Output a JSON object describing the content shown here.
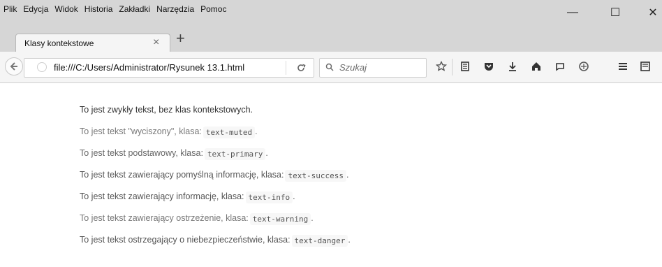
{
  "menu": {
    "items": [
      "Plik",
      "Edycja",
      "Widok",
      "Historia",
      "Zakładki",
      "Narzędzia",
      "Pomoc"
    ]
  },
  "window": {
    "minimize_label": "—",
    "maximize_label": "☐",
    "close_label": "✕"
  },
  "tab": {
    "title": "Klasy kontekstowe",
    "close_label": "×",
    "new_tab_label": "+"
  },
  "nav": {
    "url": "file:///C:/Users/Administrator/Rysunek 13.1.html",
    "search_placeholder": "Szukaj",
    "icons": [
      "star-icon",
      "reader-icon",
      "pocket-icon",
      "download-icon",
      "home-icon",
      "chat-icon",
      "sync-icon",
      "menu-icon",
      "extension-icon"
    ]
  },
  "content": {
    "lines": [
      {
        "text": "To jest zwykły tekst, bez klas kontekstowych.",
        "code": "",
        "suffix": ""
      },
      {
        "text": "To jest tekst \"wyciszony\", klasa:",
        "code": "text-muted",
        "suffix": "."
      },
      {
        "text": "To jest tekst podstawowy, klasa:",
        "code": "text-primary",
        "suffix": "."
      },
      {
        "text": "To jest tekst zawierający pomyślną informację, klasa:",
        "code": "text-success",
        "suffix": "."
      },
      {
        "text": "To jest tekst zawierający informację, klasa:",
        "code": "text-info",
        "suffix": "."
      },
      {
        "text": "To jest tekst zawierający ostrzeżenie, klasa:",
        "code": "text-warning",
        "suffix": "."
      },
      {
        "text": "To jest tekst ostrzegający o niebezpieczeństwie, klasa:",
        "code": "text-danger",
        "suffix": "."
      }
    ]
  }
}
